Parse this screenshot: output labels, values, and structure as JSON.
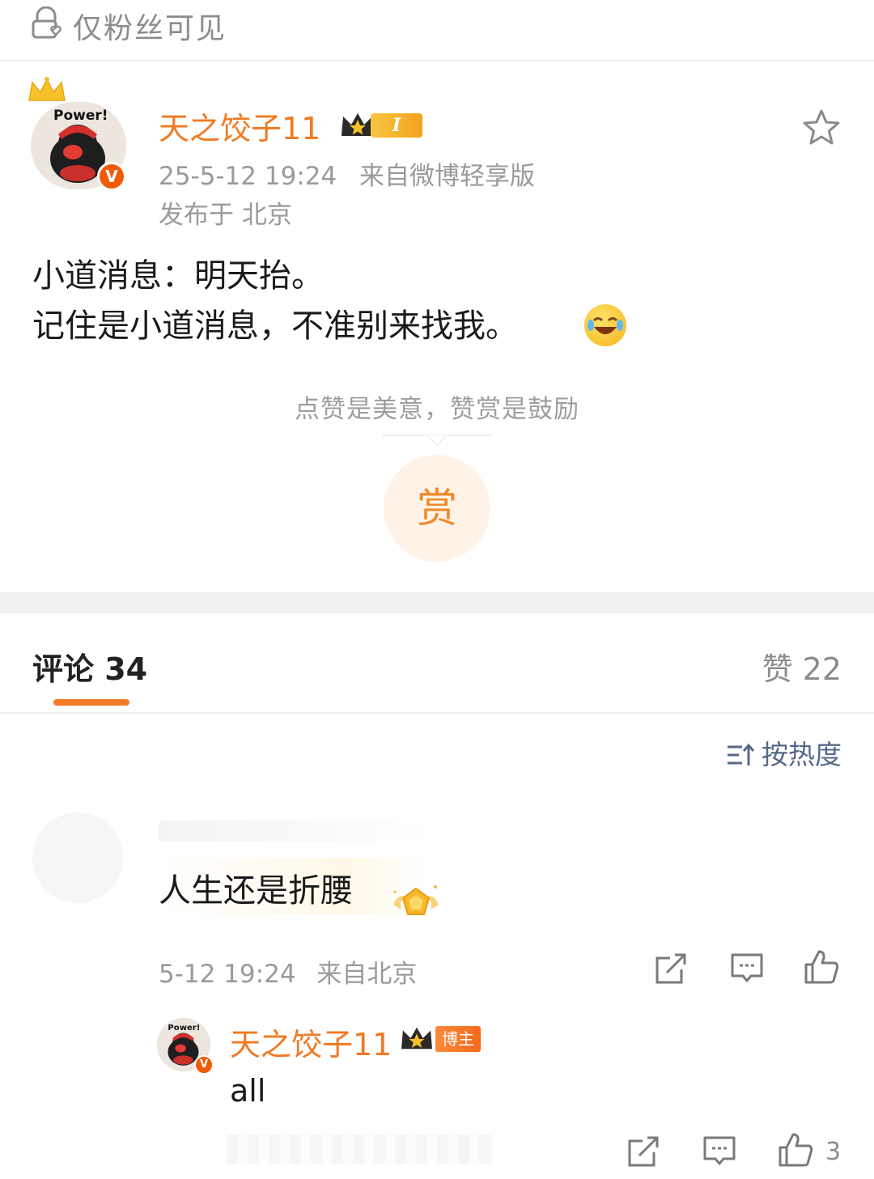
{
  "visibility": {
    "label": "仅粉丝可见"
  },
  "post": {
    "author": "天之饺子11",
    "level_badge": "I",
    "avatar_caption": "Power!",
    "verified_mark": "V",
    "time": "25-5-12 19:24",
    "source": "来自微博轻享版",
    "location": "发布于 北京",
    "lines": [
      "小道消息：明天抬。",
      "记住是小道消息，不准别来找我。"
    ],
    "emoji": "laughing-tears-emoji"
  },
  "reward": {
    "hint": "点赞是美意，赞赏是鼓励",
    "button": "赏"
  },
  "tabs": {
    "comments": "评论 34",
    "likes": "赞 22"
  },
  "sort": {
    "label": "按热度"
  },
  "comment": {
    "text": "人生还是折腰",
    "time": "5-12 19:24",
    "location": "来自北京"
  },
  "reply": {
    "author": "天之饺子11",
    "role_badge": "博主",
    "text": "all",
    "like_count": "3"
  },
  "colors": {
    "accent_orange": "#f47b25",
    "author_orange": "#f07a22",
    "muted_gray": "#9a9a9a",
    "sort_blue": "#55688a"
  }
}
